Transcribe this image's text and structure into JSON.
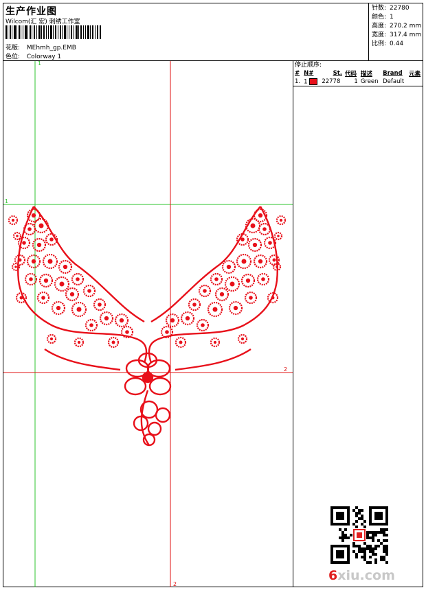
{
  "header": {
    "title": "生产作业图",
    "studio": "Wilcom(汇 宏) 刺绣工作室",
    "design_label": "花版:",
    "design_value": "MEhmh_gp.EMB",
    "colorway_label": "色位:",
    "colorway_value": "Colorway 1"
  },
  "stats": [
    {
      "label": "针数:",
      "value": "22780"
    },
    {
      "label": "颜色:",
      "value": "1"
    },
    {
      "label": "高度:",
      "value": "270.2 mm"
    },
    {
      "label": "宽度:",
      "value": "317.4 mm"
    },
    {
      "label": "比例:",
      "value": "0.44"
    }
  ],
  "stop_sequence": {
    "title": "停止顺序:",
    "headers": [
      "#",
      "N#",
      "St.",
      "代码",
      "描述",
      "Brand",
      "元素"
    ],
    "rows": [
      {
        "index": "1.",
        "n": "1",
        "stitches": "22778",
        "code": "1",
        "description": "Green",
        "brand": "Default",
        "swatch_color": "#e8101a"
      }
    ]
  },
  "guides": {
    "vertical_label_top": "1",
    "vertical_label_bottom": "2",
    "horizontal_label_left": "1",
    "horizontal_label_right": "2"
  },
  "colors": {
    "embroidery": "#e8101a",
    "guide_green": "#2cc62c",
    "guide_red": "#e01010"
  },
  "watermark": {
    "text_num": "6",
    "text_rest": "xiu.com"
  }
}
